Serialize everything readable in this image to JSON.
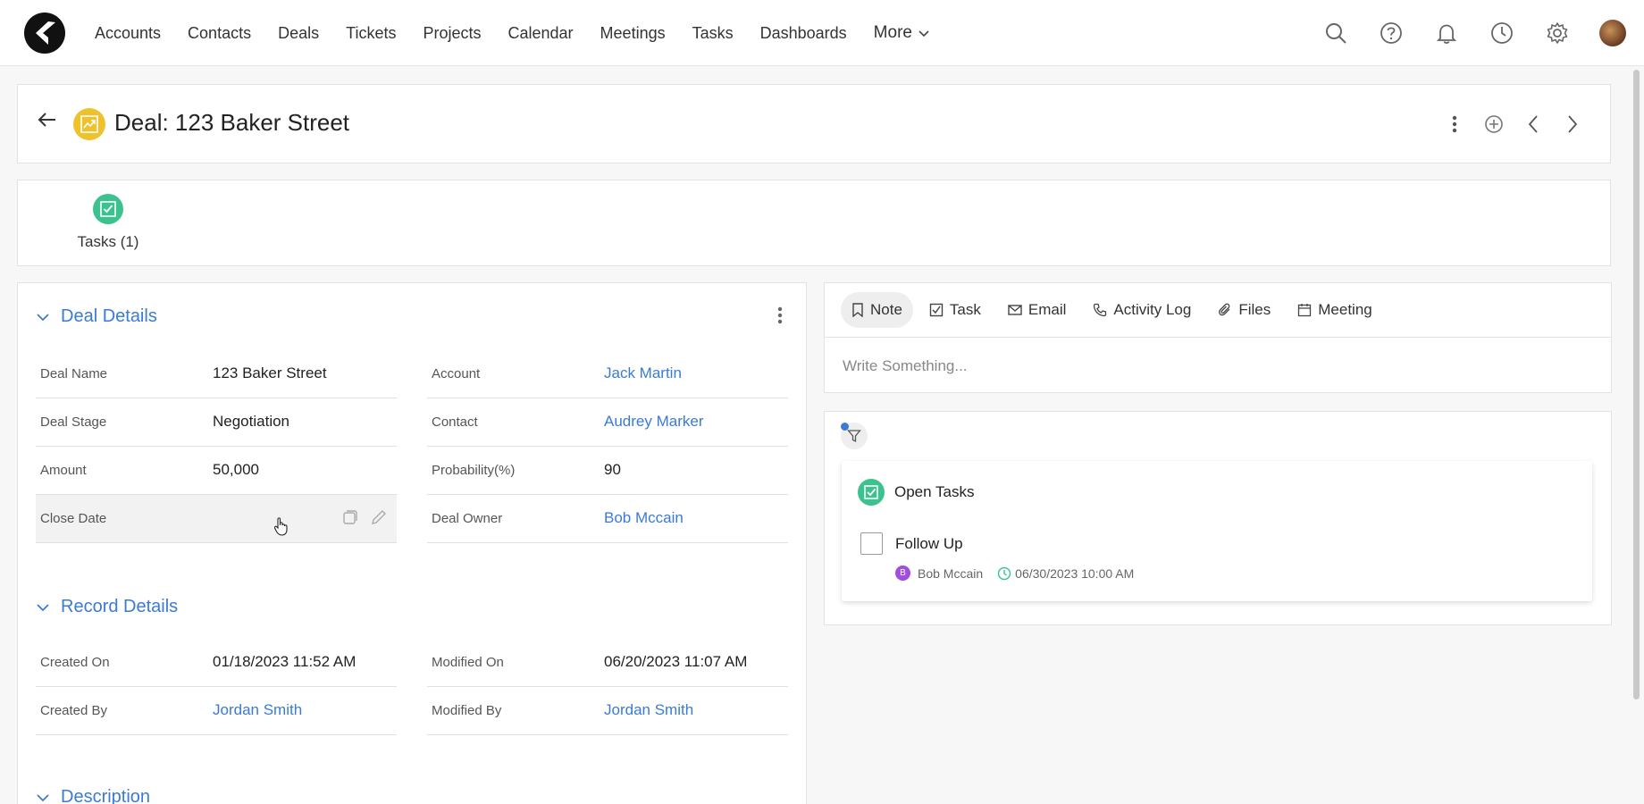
{
  "nav": {
    "items": [
      "Accounts",
      "Contacts",
      "Deals",
      "Tickets",
      "Projects",
      "Calendar",
      "Meetings",
      "Tasks",
      "Dashboards"
    ],
    "more_label": "More"
  },
  "record": {
    "title": "Deal: 123 Baker Street"
  },
  "related": {
    "tasks_label": "Tasks (1)"
  },
  "deal_details": {
    "section_title": "Deal Details",
    "left": [
      {
        "label": "Deal Name",
        "value": "123 Baker Street"
      },
      {
        "label": "Deal Stage",
        "value": "Negotiation"
      },
      {
        "label": "Amount",
        "value": "50,000"
      },
      {
        "label": "Close Date",
        "value": ""
      }
    ],
    "right": [
      {
        "label": "Account",
        "value": "Jack Martin"
      },
      {
        "label": "Contact",
        "value": "Audrey Marker"
      },
      {
        "label": "Probability(%)",
        "value": "90"
      },
      {
        "label": "Deal Owner",
        "value": "Bob Mccain"
      }
    ]
  },
  "record_details": {
    "section_title": "Record Details",
    "left": [
      {
        "label": "Created On",
        "value": "01/18/2023 11:52 AM"
      },
      {
        "label": "Created By",
        "value": "Jordan Smith"
      }
    ],
    "right": [
      {
        "label": "Modified On",
        "value": "06/20/2023 11:07 AM"
      },
      {
        "label": "Modified By",
        "value": "Jordan Smith"
      }
    ]
  },
  "description": {
    "section_title": "Description"
  },
  "composer": {
    "tabs": [
      "Note",
      "Task",
      "Email",
      "Activity Log",
      "Files",
      "Meeting"
    ],
    "placeholder": "Write Something..."
  },
  "timeline": {
    "group_title": "Open Tasks",
    "task": {
      "name": "Follow Up",
      "owner_initial": "B",
      "owner": "Bob Mccain",
      "due": "06/30/2023 10:00 AM"
    }
  },
  "colors": {
    "accent": "#3a7bd5",
    "deal_icon": "#eec22c",
    "task_green": "#3cc28f",
    "owner_purple": "#a14ee0"
  }
}
